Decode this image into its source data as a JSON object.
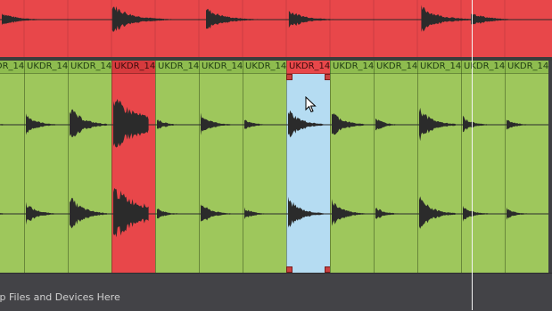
{
  "colors": {
    "top_lane": "#e8474a",
    "clip_green": "#9ec75c",
    "clip_green_header": "#8ebc4f",
    "clip_red": "#e8474a",
    "clip_red_header": "#d63a3d",
    "clip_selected": "#b5dcf2",
    "clip_selected_header": "#e8474a",
    "waveform": "#2b2b2b",
    "drop_area": "#434347",
    "playhead": "#f4f4f4"
  },
  "top_lane": {
    "name": "top-lane",
    "hit_positions": [
      0.0,
      0.2,
      0.37,
      0.52,
      0.76,
      0.85
    ],
    "hit_strengths": [
      0.45,
      1.0,
      0.75,
      0.6,
      0.85,
      0.5
    ]
  },
  "clips": [
    {
      "label": "UKDR_14",
      "state": "normal"
    },
    {
      "label": "UKDR_14",
      "state": "normal"
    },
    {
      "label": "UKDR_14",
      "state": "normal"
    },
    {
      "label": "UKDR_14",
      "state": "red"
    },
    {
      "label": "UKDR_14",
      "state": "normal"
    },
    {
      "label": "UKDR_14",
      "state": "normal"
    },
    {
      "label": "UKDR_14",
      "state": "normal"
    },
    {
      "label": "UKDR_14",
      "state": "selected"
    },
    {
      "label": "UKDR_14",
      "state": "normal"
    },
    {
      "label": "UKDR_14",
      "state": "normal"
    },
    {
      "label": "UKDR_14",
      "state": "normal"
    },
    {
      "label": "UKDR_14",
      "state": "normal"
    },
    {
      "label": "UKDR_14",
      "state": "normal"
    }
  ],
  "drop_area": {
    "label": "Drop Files and Devices Here"
  },
  "icons": {
    "cursor": "cursor-arrow-icon",
    "selection_handle": "selection-handle-icon"
  }
}
